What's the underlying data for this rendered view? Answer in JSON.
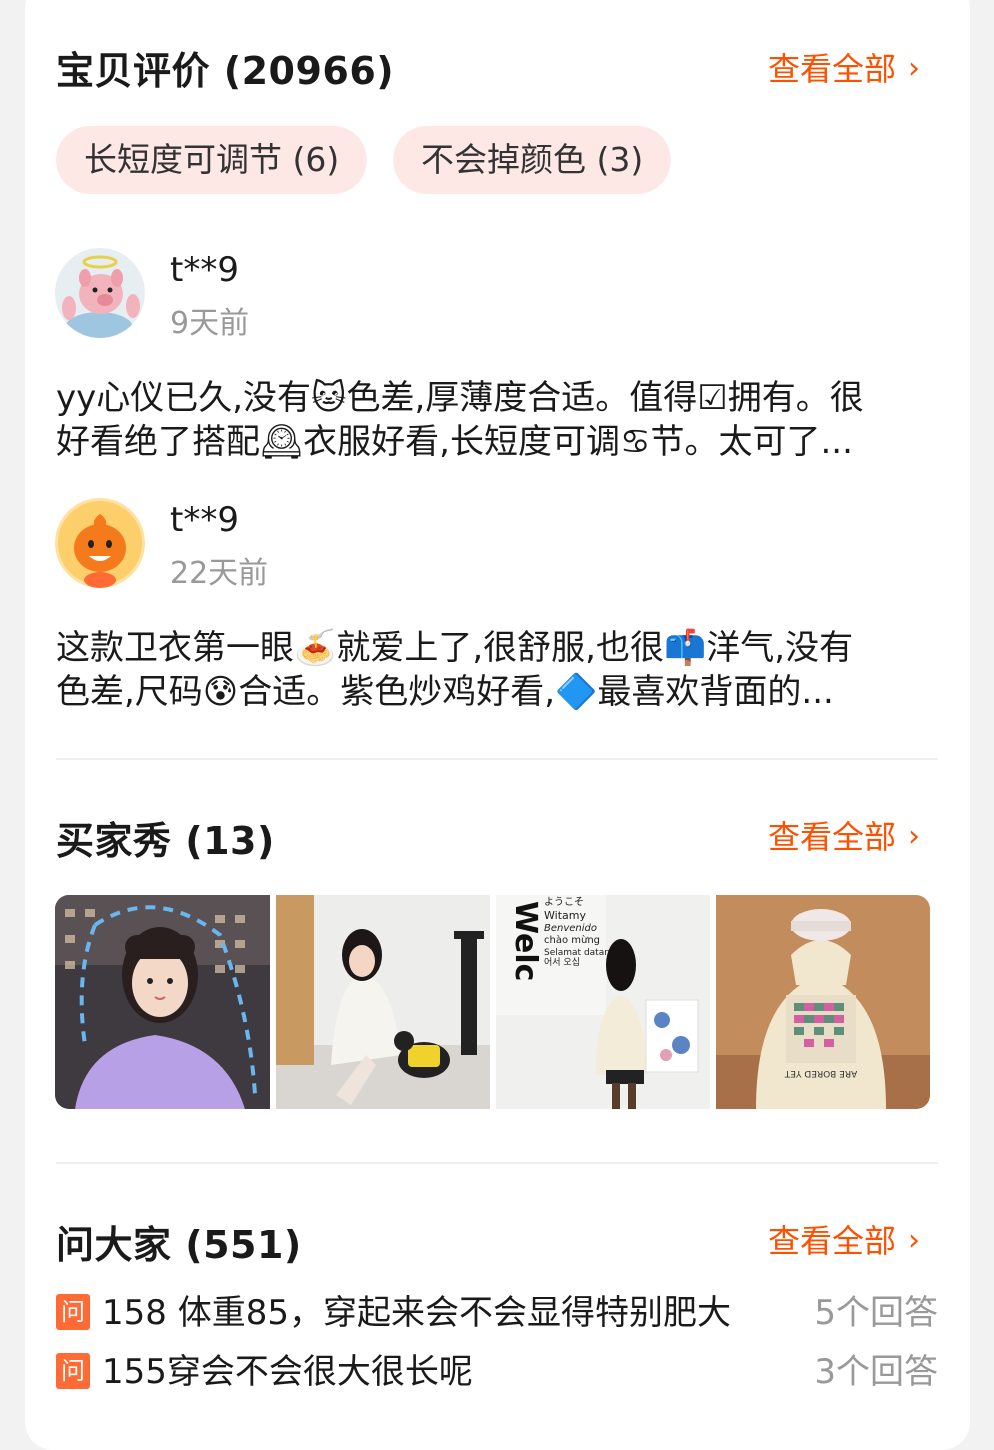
{
  "reviews": {
    "title": "宝贝评价 (20966)",
    "view_all": "查看全部",
    "tags": [
      {
        "label": "长短度可调节 (6)"
      },
      {
        "label": "不会掉颜色 (3)"
      }
    ],
    "items": [
      {
        "user": "t**9",
        "time": "9天前",
        "line1": "yy心仪已久,没有🐱色差,厚薄度合适。值得☑拥有。很",
        "line2": "好看绝了搭配🕰衣服好看,长短度可调♋节。太可了..."
      },
      {
        "user": "t**9",
        "time": "22天前",
        "line1": "这款卫衣第一眼🍝就爱上了,很舒服,也很📫洋气,没有",
        "line2": "色差,尺码😰合适。紫色炒鸡好看,🔷最喜欢背面的..."
      }
    ]
  },
  "buyer_show": {
    "title": "买家秀 (13)",
    "view_all": "查看全部",
    "photo3_text": [
      "Welc",
      "ようこそ",
      "Witamy",
      "Benvenido",
      "chào mừng",
      "Selamat datang",
      "어서 오십"
    ],
    "photo4_text": "ARE BORED YET"
  },
  "ask_everyone": {
    "title": "问大家 (551)",
    "view_all": "查看全部",
    "badge": "问",
    "questions": [
      {
        "text": "158 体重85，穿起来会不会显得特别肥大",
        "answers": "5个回答"
      },
      {
        "text": "155穿会不会很大很长呢",
        "answers": "3个回答"
      }
    ]
  },
  "colors": {
    "accent": "#ff5000",
    "tag_bg": "#fde8e6",
    "muted": "#999999"
  }
}
